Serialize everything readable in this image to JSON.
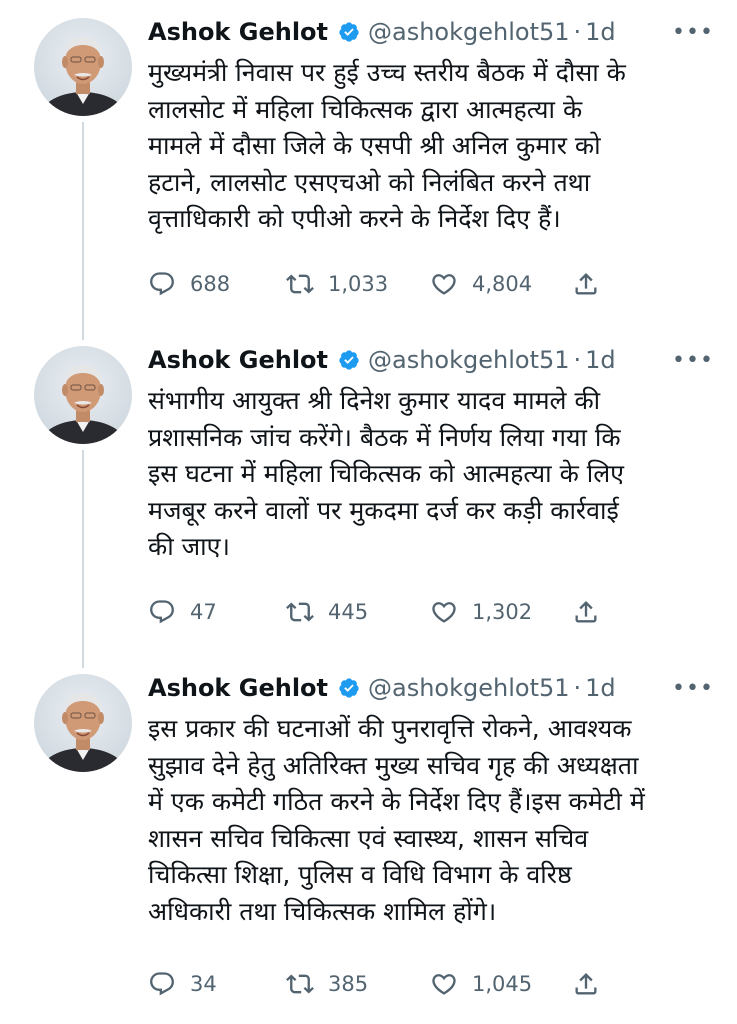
{
  "tweets": [
    {
      "name": "Ashok Gehlot",
      "handle": "@ashokgehlot51",
      "separator": "·",
      "time": "1d",
      "text": "मुख्यमंत्री निवास पर हुई उच्च स्तरीय बैठक में दौसा के\nलालसोट में महिला चिकित्सक द्वारा आत्महत्या के\nमामले में दौसा जिले के एसपी श्री अनिल कुमार को\nहटाने, लालसोट एसएचओ को निलंबित करने तथा\nवृत्ताधिकारी को एपीओ करने के निर्देश दिए हैं।",
      "replies": "688",
      "retweets": "1,033",
      "likes": "4,804"
    },
    {
      "name": "Ashok Gehlot",
      "handle": "@ashokgehlot51",
      "separator": "·",
      "time": "1d",
      "text": "संभागीय आयुक्त श्री दिनेश कुमार यादव मामले की\nप्रशासनिक जांच करेंगे। बैठक में निर्णय लिया गया कि\nइस घटना में महिला चिकित्सक को आत्महत्या के लिए\nमजबूर करने वालों पर मुकदमा दर्ज कर कड़ी कार्रवाई\nकी जाए।",
      "replies": "47",
      "retweets": "445",
      "likes": "1,302"
    },
    {
      "name": "Ashok Gehlot",
      "handle": "@ashokgehlot51",
      "separator": "·",
      "time": "1d",
      "text": "इस प्रकार की घटनाओं की पुनरावृत्ति रोकने, आवश्यक\nसुझाव देने हेतु अतिरिक्त मुख्य सचिव गृह की अध्यक्षता\nमें एक कमेटी गठित करने के निर्देश दिए हैं।इस कमेटी में\nशासन सचिव चिकित्सा एवं स्वास्थ्य, शासन सचिव\nचिकित्सा शिक्षा, पुलिस व विधि विभाग के वरिष्ठ\nअधिकारी तथा चिकित्सक शामिल होंगे।",
      "replies": "34",
      "retweets": "385",
      "likes": "1,045"
    }
  ],
  "icons": {
    "verified": "verified-badge-icon",
    "more": "more-options-icon",
    "reply": "reply-icon",
    "retweet": "retweet-icon",
    "like": "heart-icon",
    "share": "share-icon"
  },
  "colors": {
    "text": "#0f1419",
    "secondary": "#536471",
    "verified": "#1d9bf0",
    "thread_line": "#cfd9de"
  }
}
